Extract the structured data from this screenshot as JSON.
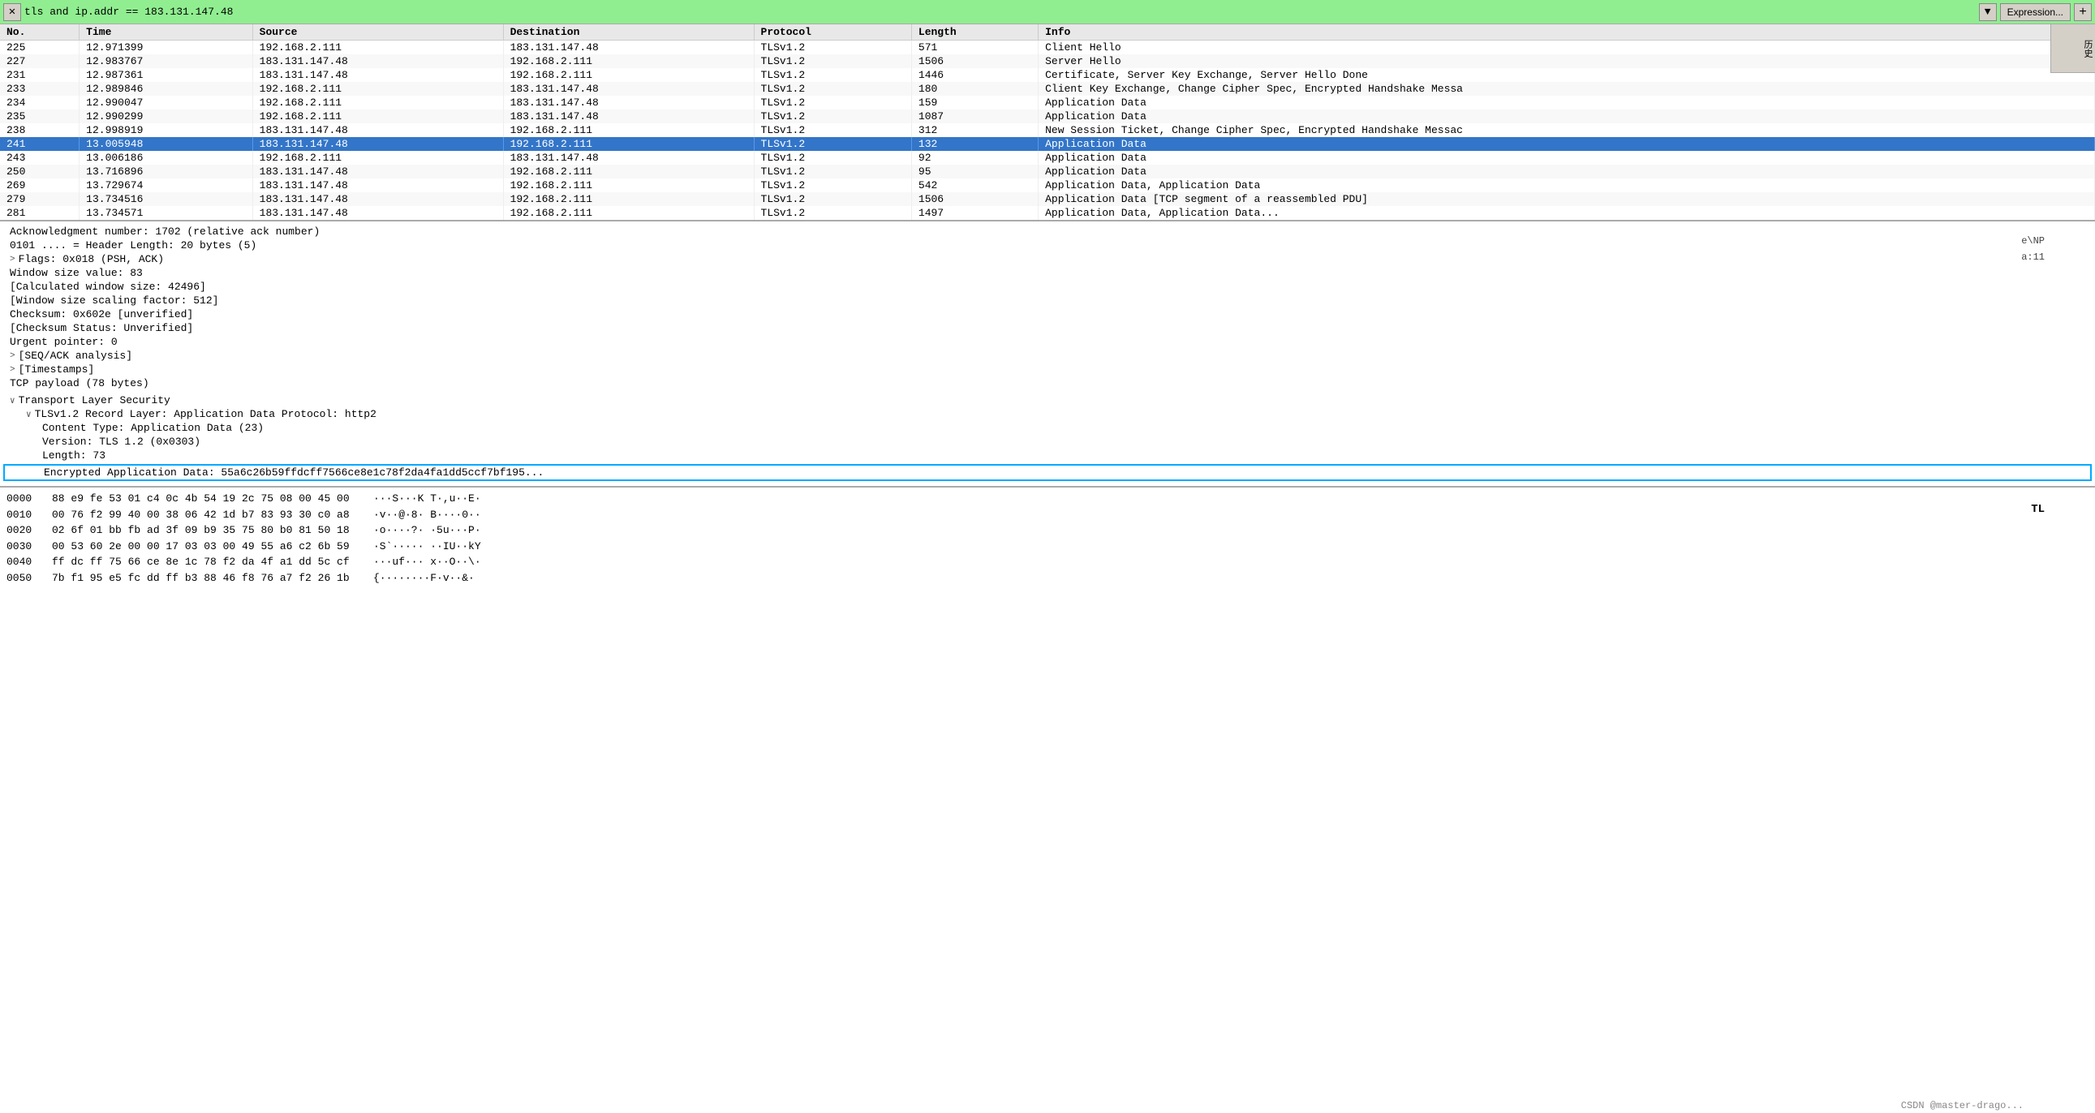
{
  "filter": {
    "value": "tls and ip.addr == 183.131.147.48",
    "expression_label": "Expression...",
    "plus_label": "+"
  },
  "columns": [
    {
      "id": "no",
      "label": "No."
    },
    {
      "id": "time",
      "label": "Time"
    },
    {
      "id": "source",
      "label": "Source"
    },
    {
      "id": "destination",
      "label": "Destination"
    },
    {
      "id": "protocol",
      "label": "Protocol"
    },
    {
      "id": "length",
      "label": "Length"
    },
    {
      "id": "info",
      "label": "Info"
    }
  ],
  "packets": [
    {
      "no": "225",
      "time": "12.971399",
      "source": "192.168.2.111",
      "destination": "183.131.147.48",
      "protocol": "TLSv1.2",
      "length": "571",
      "info": "Client Hello",
      "selected": false
    },
    {
      "no": "227",
      "time": "12.983767",
      "source": "183.131.147.48",
      "destination": "192.168.2.111",
      "protocol": "TLSv1.2",
      "length": "1506",
      "info": "Server Hello",
      "selected": false
    },
    {
      "no": "231",
      "time": "12.987361",
      "source": "183.131.147.48",
      "destination": "192.168.2.111",
      "protocol": "TLSv1.2",
      "length": "1446",
      "info": "Certificate, Server Key Exchange, Server Hello Done",
      "selected": false
    },
    {
      "no": "233",
      "time": "12.989846",
      "source": "192.168.2.111",
      "destination": "183.131.147.48",
      "protocol": "TLSv1.2",
      "length": "180",
      "info": "Client Key Exchange, Change Cipher Spec, Encrypted Handshake Messa",
      "selected": false
    },
    {
      "no": "234",
      "time": "12.990047",
      "source": "192.168.2.111",
      "destination": "183.131.147.48",
      "protocol": "TLSv1.2",
      "length": "159",
      "info": "Application Data",
      "selected": false
    },
    {
      "no": "235",
      "time": "12.990299",
      "source": "192.168.2.111",
      "destination": "183.131.147.48",
      "protocol": "TLSv1.2",
      "length": "1087",
      "info": "Application Data",
      "selected": false
    },
    {
      "no": "238",
      "time": "12.998919",
      "source": "183.131.147.48",
      "destination": "192.168.2.111",
      "protocol": "TLSv1.2",
      "length": "312",
      "info": "New Session Ticket, Change Cipher Spec, Encrypted Handshake Messac",
      "selected": false
    },
    {
      "no": "241",
      "time": "13.005948",
      "source": "183.131.147.48",
      "destination": "192.168.2.111",
      "protocol": "TLSv1.2",
      "length": "132",
      "info": "Application Data",
      "selected": true
    },
    {
      "no": "243",
      "time": "13.006186",
      "source": "192.168.2.111",
      "destination": "183.131.147.48",
      "protocol": "TLSv1.2",
      "length": "92",
      "info": "Application Data",
      "selected": false
    },
    {
      "no": "250",
      "time": "13.716896",
      "source": "183.131.147.48",
      "destination": "192.168.2.111",
      "protocol": "TLSv1.2",
      "length": "95",
      "info": "Application Data",
      "selected": false
    },
    {
      "no": "269",
      "time": "13.729674",
      "source": "183.131.147.48",
      "destination": "192.168.2.111",
      "protocol": "TLSv1.2",
      "length": "542",
      "info": "Application Data, Application Data",
      "selected": false
    },
    {
      "no": "279",
      "time": "13.734516",
      "source": "183.131.147.48",
      "destination": "192.168.2.111",
      "protocol": "TLSv1.2",
      "length": "1506",
      "info": "Application Data [TCP segment of a reassembled PDU]",
      "selected": false
    },
    {
      "no": "281",
      "time": "13.734571",
      "source": "183.131.147.48",
      "destination": "192.168.2.111",
      "protocol": "TLSv1.2",
      "length": "1497",
      "info": "Application Data, Application Data...",
      "selected": false
    }
  ],
  "detail": {
    "lines": [
      {
        "indent": 0,
        "expandable": false,
        "text": "Acknowledgment number: 1702  (relative ack number)"
      },
      {
        "indent": 0,
        "expandable": false,
        "text": "0101 .... = Header Length: 20 bytes (5)"
      },
      {
        "indent": 0,
        "expandable": true,
        "text": "Flags: 0x018 (PSH, ACK)"
      },
      {
        "indent": 0,
        "expandable": false,
        "text": "Window size value: 83"
      },
      {
        "indent": 0,
        "expandable": false,
        "text": "[Calculated window size: 42496]"
      },
      {
        "indent": 0,
        "expandable": false,
        "text": "[Window size scaling factor: 512]"
      },
      {
        "indent": 0,
        "expandable": false,
        "text": "Checksum: 0x602e [unverified]"
      },
      {
        "indent": 0,
        "expandable": false,
        "text": "[Checksum Status: Unverified]"
      },
      {
        "indent": 0,
        "expandable": false,
        "text": "Urgent pointer: 0"
      },
      {
        "indent": 0,
        "expandable": true,
        "text": "[SEQ/ACK analysis]"
      },
      {
        "indent": 0,
        "expandable": true,
        "text": "[Timestamps]"
      },
      {
        "indent": 0,
        "expandable": false,
        "text": "TCP payload (78 bytes)"
      },
      {
        "indent": 0,
        "expandable": false,
        "text": "",
        "spacer": true
      },
      {
        "indent": 0,
        "expandable": true,
        "text": "Transport Layer Security",
        "open": true
      },
      {
        "indent": 1,
        "expandable": true,
        "text": "TLSv1.2 Record Layer: Application Data Protocol: http2",
        "open": true
      },
      {
        "indent": 2,
        "expandable": false,
        "text": "Content Type: Application Data (23)"
      },
      {
        "indent": 2,
        "expandable": false,
        "text": "Version: TLS 1.2 (0x0303)"
      },
      {
        "indent": 2,
        "expandable": false,
        "text": "Length: 73"
      },
      {
        "indent": 2,
        "expandable": false,
        "text": "Encrypted Application Data: 55a6c26b59ffdcff7566ce8e1c78f2da4fa1dd5ccf7bf195...",
        "highlighted": true
      }
    ]
  },
  "hex": {
    "lines": [
      {
        "offset": "0000",
        "bytes": "88 e9 fe 53 01 c4 0c 4b  54 19 2c 75 08 00 45 00",
        "ascii": "···S···K T·,u··E·"
      },
      {
        "offset": "0010",
        "bytes": "00 76 f2 99 40 00 38 06  42 1d b7 83 93 30 c0 a8",
        "ascii": "·v··@·8· B····0··"
      },
      {
        "offset": "0020",
        "bytes": "02 6f 01 bb fb ad 3f 09  b9 35 75 80 b0 81 50 18",
        "ascii": "·o····?· ·5u···P·"
      },
      {
        "offset": "0030",
        "bytes": "00 53 60 2e 00 00 17 03  03 00 49 55 a6 c2 6b 59",
        "ascii": "·S`····· ··IU··kY"
      },
      {
        "offset": "0040",
        "bytes": "ff dc ff 75 66 ce 8e 1c  78 f2 da 4f a1 dd 5c cf",
        "ascii": "···uf··· x··O··\\·"
      },
      {
        "offset": "0050",
        "bytes": "7b f1 95 e5 fc dd ff b3  88 46 f8 76 a7 f2 26 1b",
        "ascii": "{········F·v··&·"
      }
    ]
  },
  "watermark": "CSDN @master-drago...",
  "side_labels": {
    "history": "历史",
    "enp": "e\\NP",
    "a11": "a:11",
    "tl": "TL"
  }
}
